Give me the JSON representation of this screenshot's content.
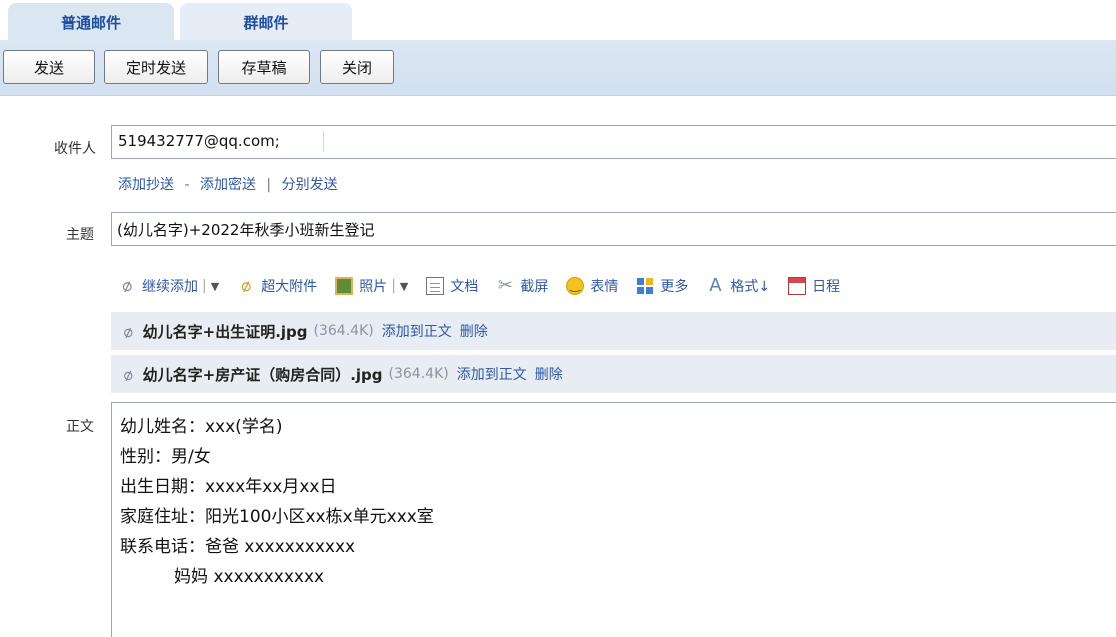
{
  "tabs": [
    {
      "label": "普通邮件"
    },
    {
      "label": "群邮件"
    }
  ],
  "toolbar": {
    "send_label": "发送",
    "timed_send_label": "定时发送",
    "save_draft_label": "存草稿",
    "close_label": "关闭"
  },
  "recipient": {
    "label": "收件人",
    "value": "519432777@qq.com;"
  },
  "cc_links": {
    "add_cc": "添加抄送",
    "dash": "-",
    "add_bcc": "添加密送",
    "bar": "|",
    "separate_send": "分别发送"
  },
  "subject": {
    "label": "主题",
    "value": "(幼儿名字)+2022年秋季小班新生登记"
  },
  "attach_toolbar": {
    "continue_add": "继续添加",
    "large_attachment": "超大附件",
    "photo": "照片",
    "document": "文档",
    "screenshot": "截屏",
    "emoji": "表情",
    "more": "更多",
    "format": "格式↓",
    "schedule": "日程"
  },
  "attachments": [
    {
      "name": "幼儿名字+出生证明.jpg",
      "size": "(364.4K)",
      "insert_label": "添加到正文",
      "delete_label": "删除"
    },
    {
      "name": "幼儿名字+房产证（购房合同）.jpg",
      "size": "(364.4K)",
      "insert_label": "添加到正文",
      "delete_label": "删除"
    }
  ],
  "body": {
    "label": "正文",
    "content": "幼儿姓名：xxx(学名)\n性别：男/女\n出生日期：xxxx年xx月xx日\n家庭住址：阳光100小区xx栋x单元xxx室\n联系电话：爸爸 xxxxxxxxxxx\n          妈妈 xxxxxxxxxxx"
  },
  "colors": {
    "toolbar_bg": "#dbe6f3",
    "link": "#2f58a6",
    "tab_text": "#1f4e9d",
    "attachment_row_bg": "#e8edf3"
  },
  "icons": {
    "continue_add": "paperclip-icon",
    "large_attachment": "gold-paperclip-icon",
    "photo": "photo-icon",
    "document": "document-icon",
    "screenshot": "scissors-icon",
    "emoji": "smiley-icon",
    "more": "grid-icon",
    "format": "text-format-icon",
    "schedule": "calendar-icon"
  }
}
